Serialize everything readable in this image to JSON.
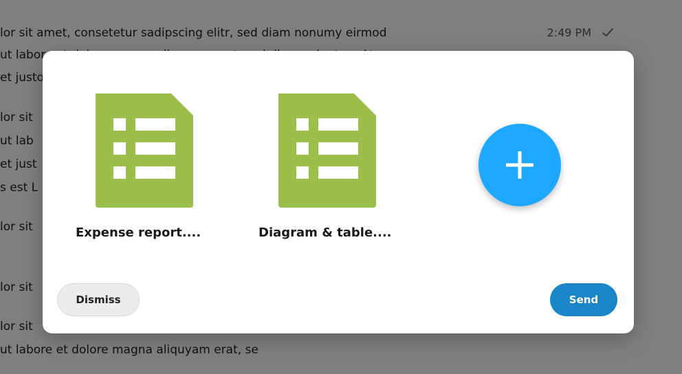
{
  "chat": {
    "lines": [
      "lor sit amet, consetetur sadipscing elitr, sed diam nonumy eirmod",
      "ut labore et dolore magna aliquyam erat, sed diam voluptua. At vero",
      "et justo duo dolores et ea rebum.",
      "lor sit",
      "ut lab",
      "et just",
      "s est L",
      "lor sit",
      "lor sit",
      "lor sit",
      "ut labore et dolore magna aliquyam erat, se"
    ],
    "time": "2:49 PM",
    "status_icon": "check-icon"
  },
  "dialog": {
    "attachments": [
      {
        "label": "Expense report....",
        "icon": "spreadsheet-file-icon",
        "color": "#9bbf4a"
      },
      {
        "label": "Diagram & table....",
        "icon": "spreadsheet-file-icon",
        "color": "#9bbf4a"
      }
    ],
    "add_button_icon": "plus-icon",
    "dismiss_label": "Dismiss",
    "send_label": "Send"
  },
  "colors": {
    "accent": "#1ea7ff",
    "send": "#1a86c7",
    "file": "#9bbf4a"
  }
}
